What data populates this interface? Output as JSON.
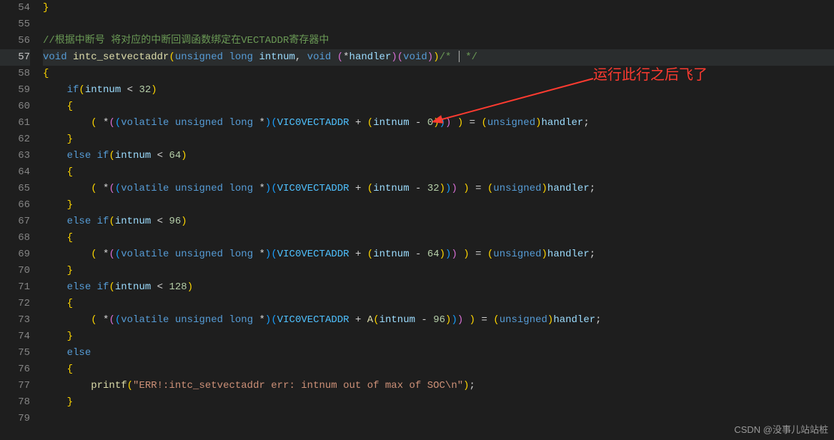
{
  "lineStart": 54,
  "lineEnd": 79,
  "currentLine": 57,
  "annotation": "运行此行之后飞了",
  "watermark": "CSDN @没事儿站站桩",
  "cursorComment": "/*  */",
  "code": {
    "comment56": "//根据中断号 将对应的中断回调函数绑定在VECTADDR寄存器中",
    "fn_kw_void": "void",
    "fn_name": "intc_setvectaddr",
    "fn_p1_type": "unsigned long",
    "fn_p1_name": "intnum",
    "fn_p2_kw": "void",
    "fn_p2_deref": "*",
    "fn_p2_name": "handler",
    "if_kw": "if",
    "elseif_kw": "else if",
    "else_kw": "else",
    "cond_var": "intnum",
    "cond_ops": [
      "<",
      "<",
      "<",
      "<"
    ],
    "cond_vals": [
      "32",
      "64",
      "96",
      "128"
    ],
    "cast_expr": "volatile unsigned long *",
    "addr_const": "VIC0VECTADDR",
    "offsets": [
      "0",
      "32",
      "64",
      "96"
    ],
    "offset_prefix3": "A",
    "rhs_cast": "unsigned",
    "rhs_var": "handler",
    "printf": "printf",
    "err_string": "\"ERR!:intc_setvectaddr err: intnum out of max of SOC\\n\""
  }
}
